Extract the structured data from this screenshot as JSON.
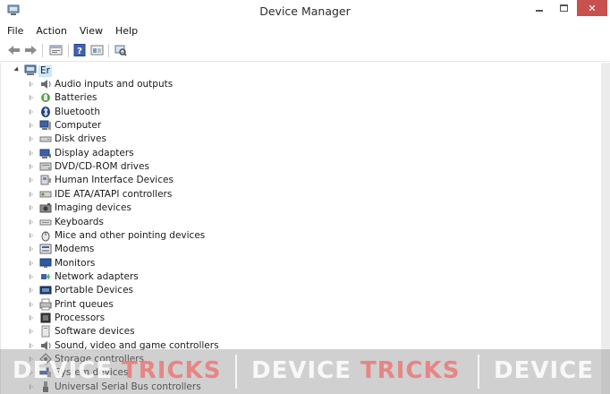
{
  "window": {
    "title": "Device Manager",
    "close_glyph": "✕"
  },
  "menu": [
    "File",
    "Action",
    "View",
    "Help"
  ],
  "toolbar": {
    "icons": [
      "back-arrow-icon",
      "forward-arrow-icon",
      "properties-icon",
      "help-icon",
      "view-icon",
      "scan-hardware-icon"
    ]
  },
  "tree": {
    "root_label": "Er",
    "items": [
      {
        "label": "Audio inputs and outputs",
        "icon": "speaker-icon"
      },
      {
        "label": "Batteries",
        "icon": "battery-icon"
      },
      {
        "label": "Bluetooth",
        "icon": "bluetooth-icon"
      },
      {
        "label": "Computer",
        "icon": "computer-icon"
      },
      {
        "label": "Disk drives",
        "icon": "disk-drive-icon"
      },
      {
        "label": "Display adapters",
        "icon": "display-adapter-icon"
      },
      {
        "label": "DVD/CD-ROM drives",
        "icon": "dvd-drive-icon"
      },
      {
        "label": "Human Interface Devices",
        "icon": "hid-icon"
      },
      {
        "label": "IDE ATA/ATAPI controllers",
        "icon": "ide-controller-icon"
      },
      {
        "label": "Imaging devices",
        "icon": "camera-icon"
      },
      {
        "label": "Keyboards",
        "icon": "keyboard-icon"
      },
      {
        "label": "Mice and other pointing devices",
        "icon": "mouse-icon"
      },
      {
        "label": "Modems",
        "icon": "modem-icon"
      },
      {
        "label": "Monitors",
        "icon": "monitor-icon"
      },
      {
        "label": "Network adapters",
        "icon": "network-adapter-icon"
      },
      {
        "label": "Portable Devices",
        "icon": "portable-device-icon"
      },
      {
        "label": "Print queues",
        "icon": "printer-icon"
      },
      {
        "label": "Processors",
        "icon": "processor-icon"
      },
      {
        "label": "Software devices",
        "icon": "software-device-icon"
      },
      {
        "label": "Sound, video and game controllers",
        "icon": "speaker-icon"
      },
      {
        "label": "Storage controllers",
        "icon": "storage-controller-icon"
      },
      {
        "label": "System devices",
        "icon": "system-device-icon"
      },
      {
        "label": "Universal Serial Bus controllers",
        "icon": "usb-icon"
      }
    ]
  },
  "watermark": {
    "word1": "DEVICE",
    "word2": "TRICKS"
  },
  "colors": {
    "close_button": "#c7514d",
    "selection": "#cde8ff",
    "watermark_red": "#eb7878"
  }
}
